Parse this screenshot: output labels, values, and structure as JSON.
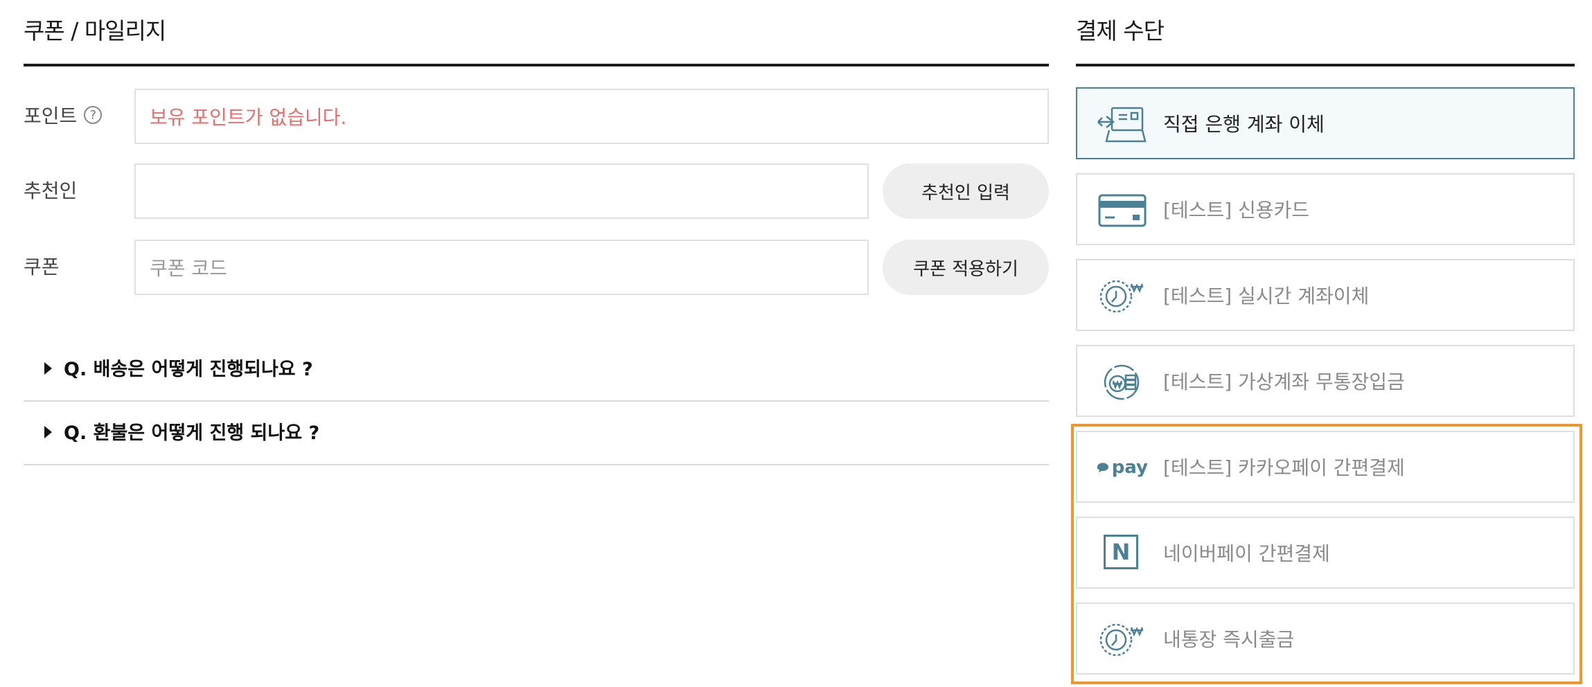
{
  "coupon_section": {
    "title": "쿠폰 / 마일리지",
    "point": {
      "label": "포인트",
      "help_glyph": "?",
      "note": "보유 포인트가 없습니다."
    },
    "recommender": {
      "label": "추천인",
      "value": "",
      "button": "추천인 입력"
    },
    "coupon": {
      "label": "쿠폰",
      "placeholder": "쿠폰 코드",
      "button": "쿠폰 적용하기"
    }
  },
  "faq": [
    {
      "question": "Q. 배송은 어떻게 진행되나요 ?"
    },
    {
      "question": "Q. 환불은 어떻게 진행 되나요 ?"
    }
  ],
  "payment_section": {
    "title": "결제 수단",
    "methods": [
      {
        "label": "직접 은행 계좌 이체",
        "icon": "bank-transfer-icon",
        "selected": true
      },
      {
        "label": "[테스트] 신용카드",
        "icon": "credit-card-icon",
        "selected": false
      },
      {
        "label": "[테스트] 실시간 계좌이체",
        "icon": "realtime-transfer-icon",
        "selected": false
      },
      {
        "label": "[테스트] 가상계좌 무통장입금",
        "icon": "virtual-account-icon",
        "selected": false
      },
      {
        "label": "[테스트] 카카오페이 간편결제",
        "icon": "kakaopay-icon",
        "icon_text": "pay",
        "selected": false
      },
      {
        "label": "네이버페이 간편결제",
        "icon": "naverpay-icon",
        "icon_text": "N",
        "selected": false
      },
      {
        "label": "내통장 즉시출금",
        "icon": "instant-withdraw-icon",
        "selected": false
      }
    ]
  },
  "colors": {
    "accent": "#4a8195",
    "highlight": "#f0962e",
    "note": "#e56f6f"
  }
}
